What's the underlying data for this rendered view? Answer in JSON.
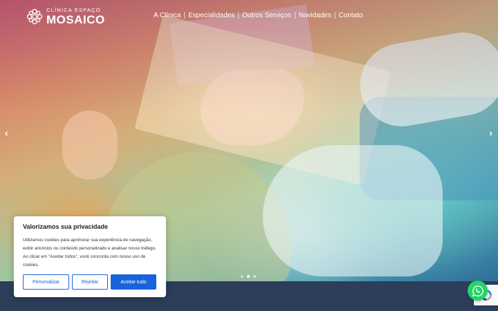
{
  "header": {
    "logo": {
      "top_text": "CLÍNICA ESPAÇO",
      "main_text": "MOSAICO",
      "icon": "mosaic-flower-icon"
    },
    "nav": [
      {
        "label": "A Clínica"
      },
      {
        "label": "Especialidades"
      },
      {
        "label": "Outros Serviços"
      },
      {
        "label": "Novidades"
      },
      {
        "label": "Contato"
      }
    ],
    "separator": "|"
  },
  "slider": {
    "prev_icon": "chevron-left-icon",
    "next_icon": "chevron-right-icon",
    "prev_glyph": "‹",
    "next_glyph": "›",
    "slide_count": 3,
    "active_slide": 2
  },
  "cookie_banner": {
    "title": "Valorizamos sua privacidade",
    "text": "Utilizamos cookies para aprimorar sua experiência de navegação, exibir anúncios ou conteúdo personalizado e analisar nosso tráfego. Ao clicar em \"Aceitar todos\", você concorda com nosso uso de cookies.",
    "customize_label": "Personalizar",
    "reject_label": "Rejeitar",
    "accept_label": "Aceitar tudo"
  },
  "widgets": {
    "whatsapp_icon": "whatsapp-icon",
    "recaptcha_icon": "recaptcha-icon"
  },
  "colors": {
    "accent_blue": "#1863dc",
    "footer_navy": "#2c3e5a",
    "whatsapp_green": "#25d366"
  }
}
